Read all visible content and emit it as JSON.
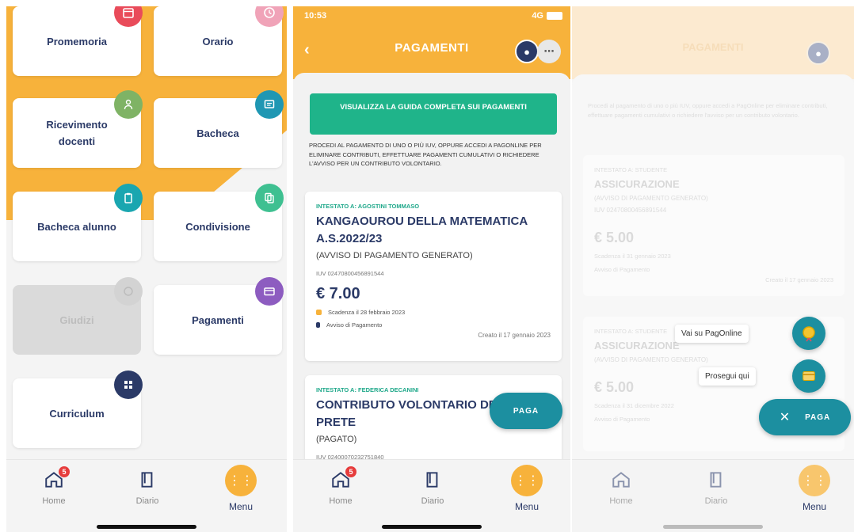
{
  "screen1": {
    "tiles": [
      {
        "label": "Promemoria",
        "icon": "calendar-icon",
        "color": "#e94b5a"
      },
      {
        "label": "Orario",
        "icon": "clock-icon",
        "color": "#f0a3b8"
      },
      {
        "label": "Ricevimento docenti",
        "icon": "teacher-icon",
        "color": "#7fb365"
      },
      {
        "label": "Bacheca",
        "icon": "board-icon",
        "color": "#1f97b3"
      },
      {
        "label": "Bacheca alunno",
        "icon": "clipboard-icon",
        "color": "#1aa6b0"
      },
      {
        "label": "Condivisione",
        "icon": "share-icon",
        "color": "#3fc091"
      },
      {
        "label": "Giudizi",
        "icon": "judgement-icon",
        "color": "#d3d3d3"
      },
      {
        "label": "Pagamenti",
        "icon": "payment-icon",
        "color": "#8d5cc0"
      },
      {
        "label": "Curriculum",
        "icon": "grid-icon",
        "color": "#2b3a67"
      }
    ],
    "tabbar": {
      "home": "Home",
      "home_badge": "5",
      "diary": "Diario",
      "menu": "Menu"
    }
  },
  "screen2": {
    "status_time": "10:53",
    "status_right": "4G",
    "title": "PAGAMENTI",
    "guide_button": "VISUALIZZA LA GUIDA COMPLETA SUI PAGAMENTI",
    "intro": "PROCEDI AL PAGAMENTO DI UNO O PIÙ IUV, OPPURE ACCEDI A PAGONLINE PER ELIMINARE CONTRIBUTI, EFFETTUARE PAGAMENTI CUMULATIVI O RICHIEDERE L'AVVISO PER UN CONTRIBUTO VOLONTARIO.",
    "payments": [
      {
        "category": "INTESTATO A: AGOSTINI TOMMASO",
        "title": "KANGAOUROU DELLA MATEMATICA A.S.2022/23",
        "type": "(AVVISO DI PAGAMENTO GENERATO)",
        "iuv": "IUV 02470800456891544",
        "amount": "€ 7.00",
        "due": "Scadenza il 28 febbraio 2023",
        "kind": "Avviso di Pagamento",
        "created": "Creato il 17 gennaio 2023"
      },
      {
        "category": "INTESTATO A: FEDERICA DECANINI",
        "title": "CONTRIBUTO VOLONTARIO DE PRETE",
        "type": "(PAGATO)",
        "iuv": "IUV 02400070232751840"
      }
    ],
    "fab": "PAGA",
    "tabbar": {
      "home": "Home",
      "home_badge": "5",
      "diary": "Diario",
      "menu": "Menu"
    }
  },
  "screen3": {
    "title": "PAGAMENTI",
    "intro": "Procedi al pagamento di uno o più IUV, oppure accedi a PagOnline per eliminare contributi, effettuare pagamenti cumulativi o richiedere l'avviso per un contributo volontario.",
    "cards": [
      {
        "category": "INTESTATO A: STUDENTE",
        "title": "ASSICURAZIONE",
        "sub": "(AVVISO DI PAGAMENTO GENERATO)",
        "iuv": "IUV 02470800456891544",
        "amount": "€ 5.00",
        "due": "Scadenza il 31 gennaio 2023",
        "kind": "Avviso di Pagamento",
        "created": "Creato il 17 gennaio 2023"
      },
      {
        "category": "INTESTATO A: STUDENTE",
        "title": "ASSICURAZIONE",
        "sub": "(AVVISO DI PAGAMENTO GENERATO)",
        "amount": "€ 5.00",
        "due": "Scadenza il 31 dicembre 2022",
        "kind": "Avviso di Pagamento",
        "created": "Creato il 17 gennaio 2023"
      }
    ],
    "options": {
      "pagonline": "Vai su PagOnline",
      "here": "Prosegui qui"
    },
    "fab": "PAGA",
    "fab_close": "✕",
    "tabbar": {
      "home": "Home",
      "diary": "Diario",
      "menu": "Menu"
    }
  },
  "colors": {
    "orange": "#f7b23b",
    "navy": "#2b3a67",
    "green": "#1fb48a",
    "teal": "#1c8fa0"
  }
}
